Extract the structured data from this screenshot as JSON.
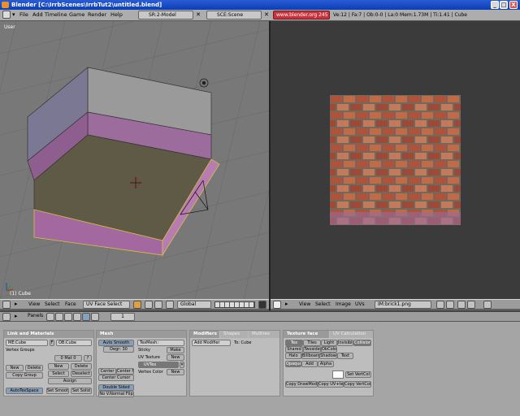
{
  "window": {
    "title": "Blender [C:\\IrrbScenes\\IrrbTut2\\untitled.blend]",
    "min": "_",
    "max": "□",
    "close": "X"
  },
  "menubar": {
    "file": "File",
    "add": "Add",
    "timeline": "Timeline",
    "game": "Game",
    "render": "Render",
    "help": "Help",
    "screen": "SR:2-Model",
    "scene": "SCE:Scene",
    "url": "www.blender.org 245",
    "stats": "Ve:12 | Fa:7 | Ob:0-0 | La:0   Mem:1.73M | Ti:1.41 | Cube"
  },
  "viewport3d": {
    "view_name": "User",
    "object_label": "(1) Cube"
  },
  "header3d": {
    "view": "View",
    "select": "Select",
    "face": "Face",
    "mode": "UV Face Select",
    "orientation": "Global"
  },
  "headerimg": {
    "view": "View",
    "select": "Select",
    "image": "Image",
    "uvs": "UVs",
    "image_name": "IM:brick1.png"
  },
  "buttons_header": {
    "panels": "Panels",
    "frame": "1"
  },
  "link_materials": {
    "title": "Link and Materials",
    "me_name": "ME:Cube",
    "f": "F",
    "ob_name": "OB:Cube",
    "vertex_groups": "Vertex Groups",
    "mat_index": "0 Mat 0",
    "q": "?",
    "new": "New",
    "delete": "Delete",
    "copy_group": "Copy Group",
    "new2": "New",
    "delete2": "Delete",
    "select": "Select",
    "deselect": "Deselect",
    "assign": "Assign",
    "autotex": "AutoTexSpace",
    "set_smooth": "Set Smooth",
    "set_solid": "Set Solid"
  },
  "mesh": {
    "title": "Mesh",
    "auto_smooth": "Auto Smooth",
    "degr": "Degr: 30",
    "texmesh": "TexMesh:",
    "sticky": "Sticky",
    "make": "Make",
    "uv_texture": "UV Texture",
    "new": "New",
    "uvtex": "UVTex",
    "vertex_color": "Vertex Color",
    "new2": "New",
    "center": "Center",
    "center_new": "Center New",
    "center_cursor": "Center Cursor",
    "double_sided": "Double Sided",
    "no_v_normal_flip": "No V.Normal Flip"
  },
  "modifiers": {
    "tab": "Modifiers",
    "tab2": "Shapes",
    "tab3": "Multires",
    "add_modifier": "Add Modifier",
    "to": "To: Cube"
  },
  "texture_face": {
    "tab": "Texture face",
    "tab2": "UV Calculation",
    "tex": "Tex",
    "tiles": "Tiles",
    "light": "Light",
    "invisible": "Invisible",
    "collision": "Collision",
    "shared": "Shared",
    "twoside": "Twoside",
    "objcolor": "ObColor",
    "halo": "Halo",
    "billboard": "Billboard",
    "shadow": "Shadow",
    "text": "Text",
    "opaque": "Opaque",
    "add": "Add",
    "alpha": "Alpha",
    "set_vertcol": "Set VertCol",
    "copy_drawmode": "Copy DrawMode",
    "copy_uv": "Copy UV+tex",
    "copy_vertcol": "Copy VertCol"
  },
  "colors": {
    "title_bar": "#0a3fb4",
    "url_bg": "#c8323c",
    "viewport_bg": "#787878",
    "image_bg": "#3b3b3b",
    "button_active": "#8aa0b8"
  }
}
